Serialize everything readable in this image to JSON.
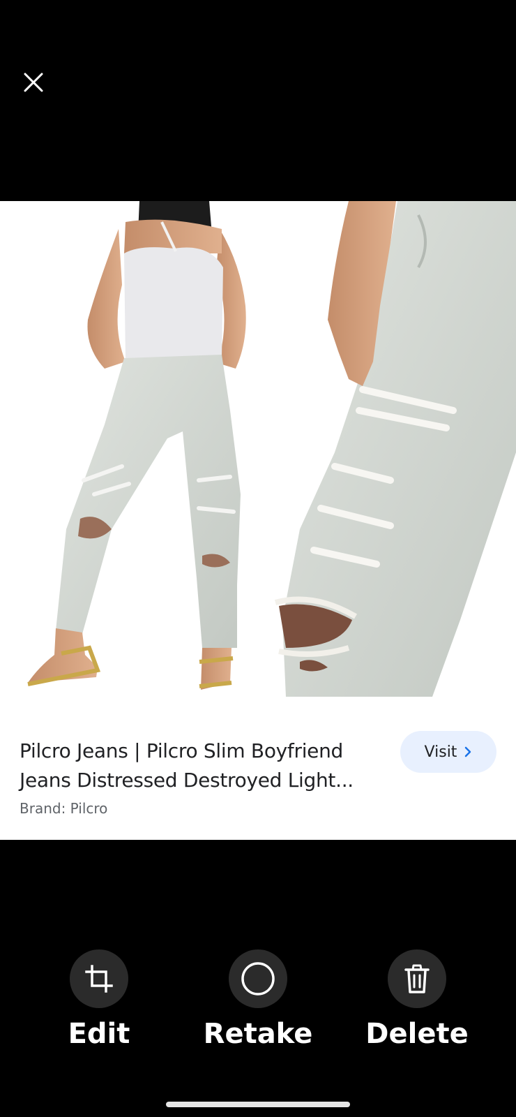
{
  "top_bar": {
    "close_icon": "close-icon"
  },
  "result_card": {
    "title": "Pilcro Jeans | Pilcro Slim Boyfriend Jeans Distressed Destroyed Light...",
    "brand": "Brand: Pilcro",
    "visit_label": "Visit",
    "visit_icon": "chevron-right-icon",
    "accent_color": "#e8f0fe",
    "chevron_color": "#1a73e8"
  },
  "actions": [
    {
      "label": "Edit",
      "icon": "crop-icon"
    },
    {
      "label": "Retake",
      "icon": "shutter-circle-icon"
    },
    {
      "label": "Delete",
      "icon": "trash-icon"
    }
  ]
}
